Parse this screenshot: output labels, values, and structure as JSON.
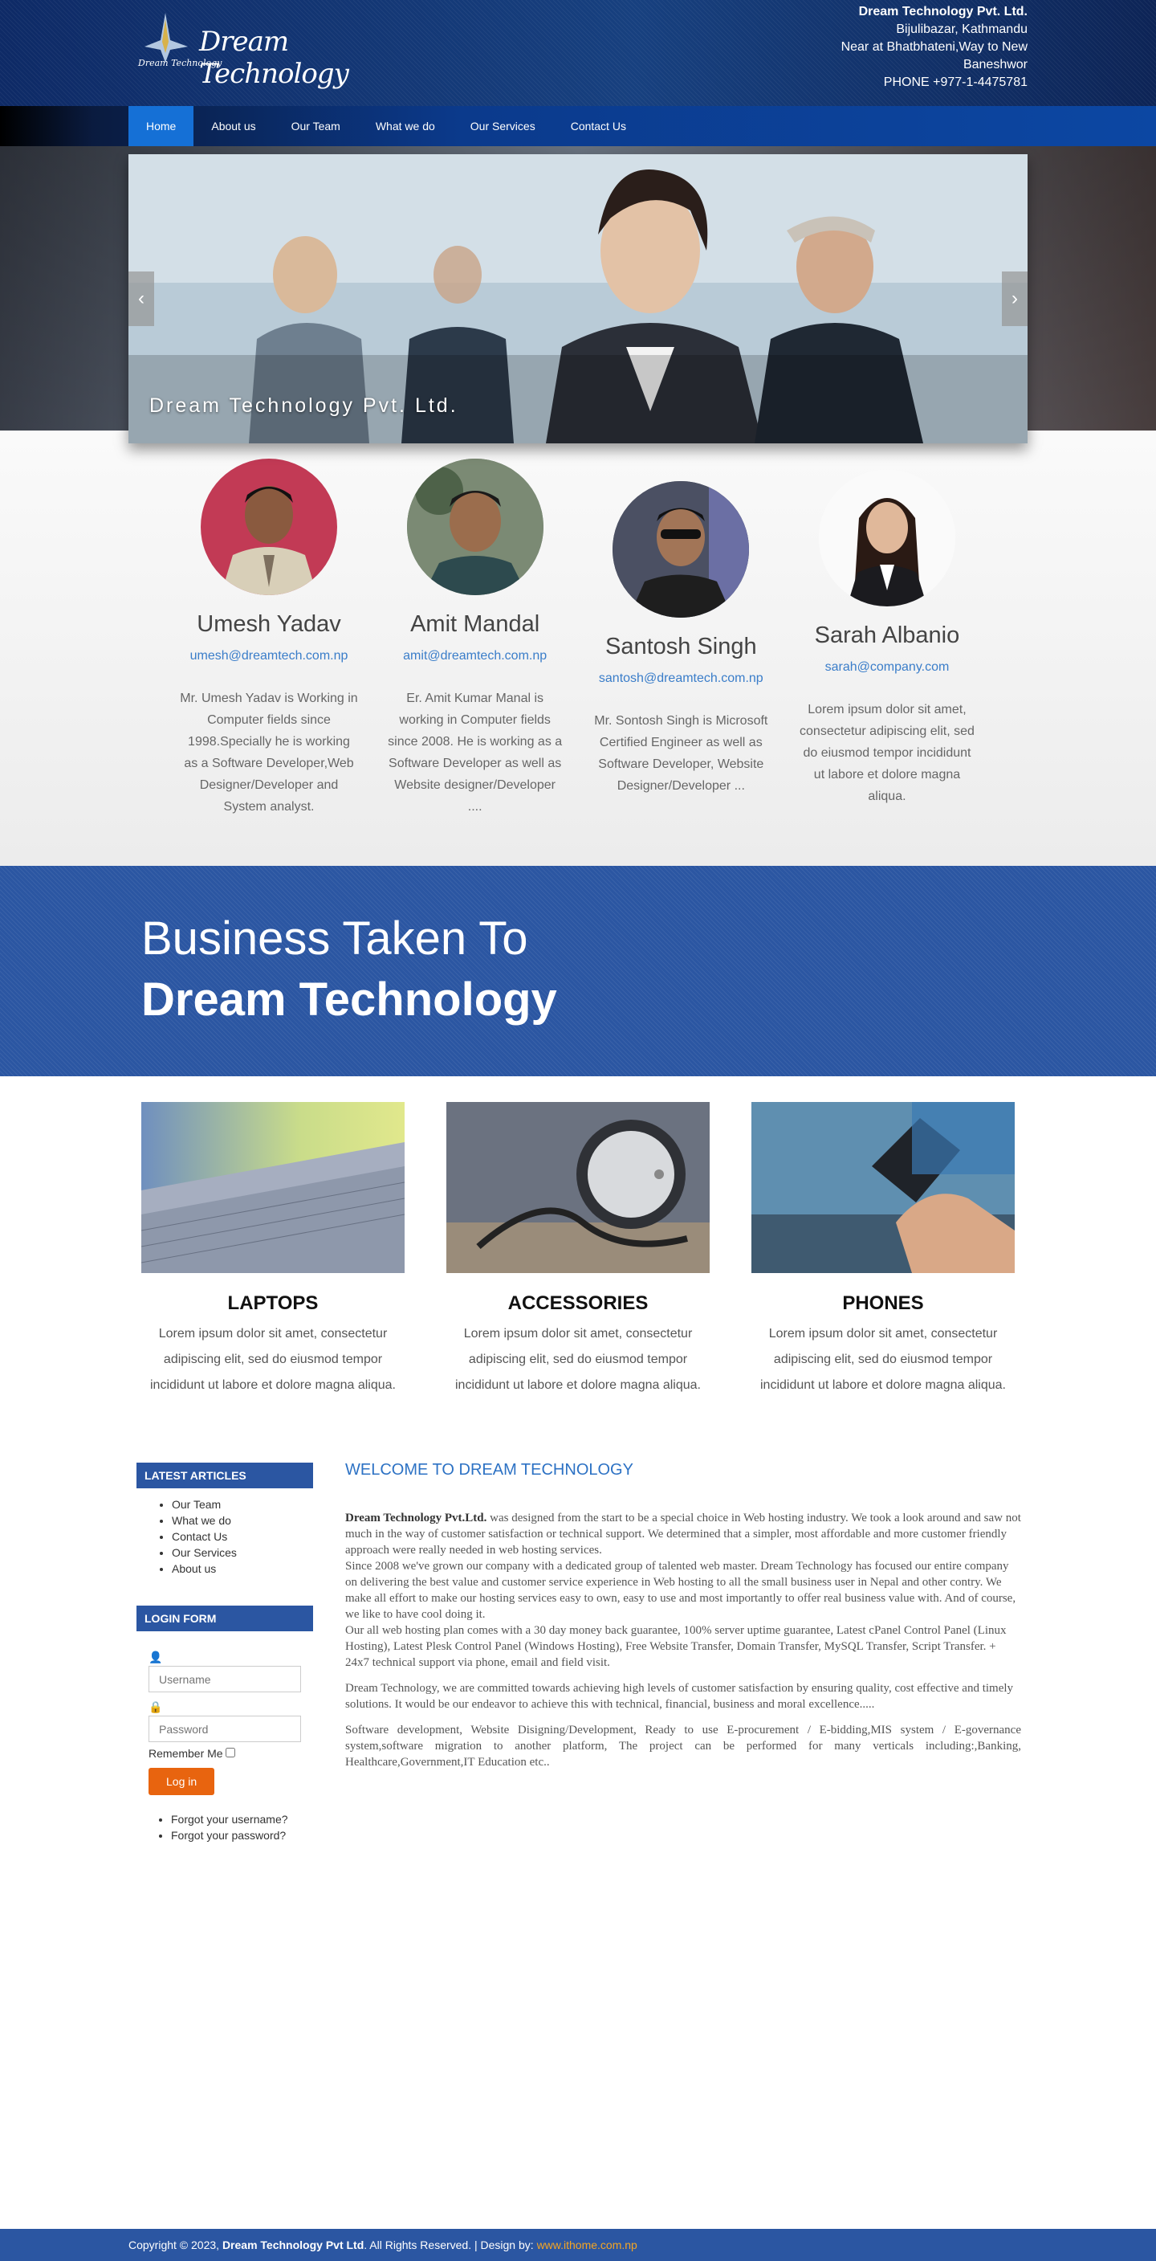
{
  "header": {
    "logo_text": "Dream Technology",
    "logo_sub": "Dream Technology",
    "company": "Dream Technology Pvt. Ltd.",
    "addr1": "Bijulibazar, Kathmandu",
    "addr2": "Near at Bhatbhateni,Way to New",
    "addr3": "Baneshwor",
    "phone": "PHONE  +977-1-4475781"
  },
  "nav": [
    "Home",
    "About us",
    "Our Team",
    "What we do",
    "Our Services",
    "Contact Us"
  ],
  "slider": {
    "caption": "Dream Technology Pvt. Ltd.",
    "prev": "‹",
    "next": "›"
  },
  "team": [
    {
      "name": "Umesh Yadav",
      "email": "umesh@dreamtech.com.np",
      "bio": "Mr. Umesh Yadav is Working in Computer fields since 1998.Specially he is working as a Software Developer,Web Designer/Developer and System analyst."
    },
    {
      "name": "Amit Mandal",
      "email": "amit@dreamtech.com.np",
      "bio": "Er. Amit Kumar Manal is working in Computer fields since 2008. He is working as a Software Developer as well as Website designer/Developer ...."
    },
    {
      "name": "Santosh Singh",
      "email": "santosh@dreamtech.com.np",
      "bio": "Mr. Sontosh Singh is Microsoft Certified Engineer as well as Software Developer, Website Designer/Developer ..."
    },
    {
      "name": "Sarah Albanio",
      "email": "sarah@company.com",
      "bio": "Lorem ipsum dolor sit amet, consectetur adipiscing elit, sed do eiusmod tempor incididunt ut labore et dolore magna aliqua."
    }
  ],
  "banner": {
    "line1": "Business Taken To",
    "line2": "Dream Technology"
  },
  "products": [
    {
      "title": "LAPTOPS",
      "text": "Lorem ipsum dolor sit amet, consectetur adipiscing elit, sed do eiusmod tempor incididunt ut labore et dolore magna aliqua."
    },
    {
      "title": "ACCESSORIES",
      "text": "Lorem ipsum dolor sit amet, consectetur adipiscing elit, sed do eiusmod tempor incididunt ut labore et dolore magna aliqua."
    },
    {
      "title": "PHONES",
      "text": "Lorem ipsum dolor sit amet, consectetur adipiscing elit, sed do eiusmod tempor incididunt ut labore et dolore magna aliqua."
    }
  ],
  "sidebar": {
    "articles_title": "LATEST ARTICLES",
    "articles": [
      "Our Team",
      "What we do",
      "Contact Us",
      "Our Services",
      "About us"
    ],
    "login_title": "LOGIN FORM",
    "username_placeholder": "Username",
    "password_placeholder": "Password",
    "remember": "Remember Me",
    "login_button": "Log in",
    "forgot_username": "Forgot your username?",
    "forgot_password": "Forgot your password?"
  },
  "main": {
    "heading": "WELCOME TO DREAM TECHNOLOGY",
    "p1_bold": "Dream Technology Pvt.Ltd.",
    "p1": " was designed from the start to be a special choice in Web hosting industry. We took a look around and saw not much in the way of customer satisfaction or technical support. We determined that a simpler, most affordable and more customer friendly approach were really needed in web hosting services.",
    "p2": "Since 2008 we've grown our company with a dedicated group of talented web master. Dream Technology  has focused our entire company on delivering the best value and customer service experience in Web hosting to all the small business user in Nepal and other contry. We make all effort to make our hosting services easy to own, easy to use and most importantly to offer real business value with. And of course, we like to have cool doing it.",
    "p3": "Our all web hosting plan comes with a 30 day money back guarantee, 100% server uptime guarantee, Latest cPanel Control Panel (Linux Hosting), Latest Plesk Control Panel (Windows Hosting), Free Website Transfer, Domain Transfer, MySQL Transfer, Script Transfer. + 24x7 technical support via phone, email and field visit.",
    "p4": "Dream Technology, we are committed towards achieving high levels of customer satisfaction by ensuring quality, cost effective and timely solutions. It would be our endeavor to achieve this with technical, financial, business and moral excellence.....",
    "p5": "Software development, Website Disigning/Development, Ready to use E-procurement / E-bidding,MIS system / E-governance system,software migration to another platform, The project can be performed for many verticals including:,Banking, Healthcare,Government,IT Education etc.."
  },
  "footer": {
    "prefix": "Copyright © 2023, ",
    "company": "Dream Technology Pvt Ltd",
    "middle": ". All Rights Reserved. |  Design by: ",
    "link": "www.ithome.com.np"
  },
  "colors": {
    "accent": "#2b56a2",
    "link": "#3a7dc9",
    "button": "#e8640f",
    "footer_link": "#f6a623"
  }
}
